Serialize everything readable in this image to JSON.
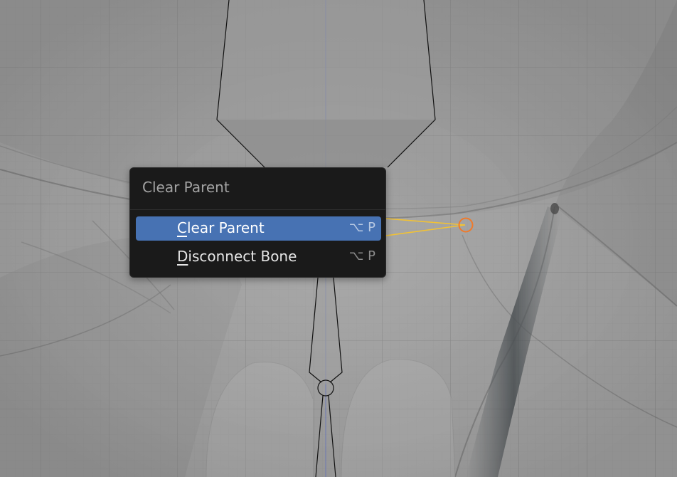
{
  "menu": {
    "title": "Clear Parent",
    "items": [
      {
        "label_underlined": "C",
        "label_rest": "lear Parent",
        "shortcut": "⌥ P",
        "active": true
      },
      {
        "label_underlined": "D",
        "label_rest": "isconnect Bone",
        "shortcut": "⌥ P",
        "active": false
      }
    ]
  },
  "colors": {
    "highlight": "#4772b3",
    "menu_bg": "#1a1a1a",
    "relation_line": "#f2c234",
    "selected_joint": "#f07a2a"
  }
}
